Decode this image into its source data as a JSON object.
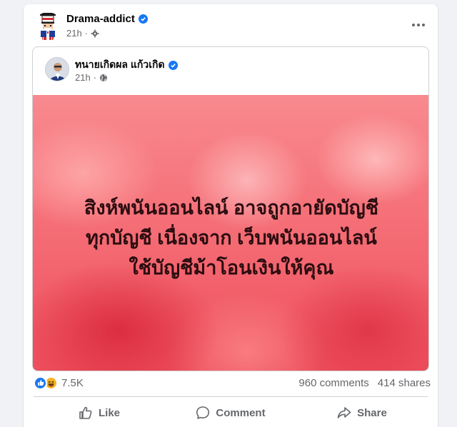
{
  "post": {
    "page_name": "Drama-addict",
    "time": "21h",
    "separator": "·"
  },
  "shared_post": {
    "author": "ทนายเกิดผล แก้วเกิด",
    "time": "21h",
    "separator": "·",
    "image_text": [
      "สิงห์พนันออนไลน์ อาจถูกอายัดบัญชี",
      "ทุกบัญชี เนื่องจาก เว็บพนันออนไลน์",
      "ใช้บัญชีม้าโอนเงินให้คุณ"
    ]
  },
  "stats": {
    "reactions_count": "7.5K",
    "comments": "960 comments",
    "shares": "414 shares"
  },
  "actions": {
    "like": "Like",
    "comment": "Comment",
    "share": "Share"
  },
  "colors": {
    "facebook_blue": "#1877f2",
    "secondary_text": "#65676b",
    "background": "#f0f2f5"
  },
  "icons": [
    "uncle-sam-avatar-icon",
    "verified-badge-icon",
    "gear-audience-icon",
    "more-options-icon",
    "globe-audience-icon",
    "like-reaction-icon",
    "haha-reaction-icon",
    "thumb-up-icon",
    "speech-bubble-icon",
    "share-arrow-icon"
  ]
}
